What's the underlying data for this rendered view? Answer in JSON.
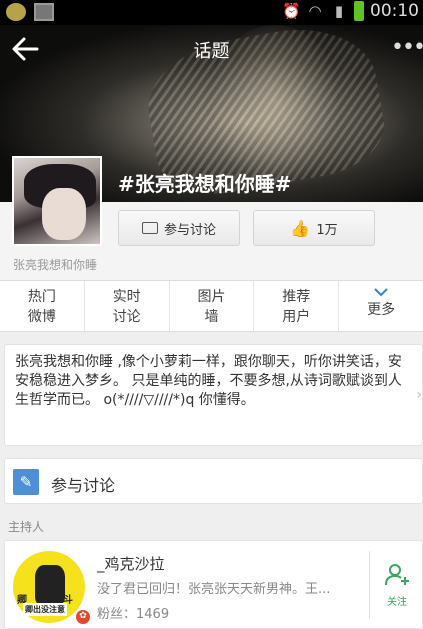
{
  "status_bar": {
    "time": "00:10"
  },
  "nav": {
    "title": "话题"
  },
  "topic": {
    "title": "#张亮我想和你睡#",
    "host_display_name": "张亮我想和你睡"
  },
  "actions": {
    "discuss_label": "参与讨论",
    "like_count": "1万"
  },
  "tabs": [
    {
      "line1": "热门",
      "line2": "微博"
    },
    {
      "line1": "实时",
      "line2": "讨论"
    },
    {
      "line1": "图片",
      "line2": "墙"
    },
    {
      "line1": "推荐",
      "line2": "用户"
    },
    {
      "line1": "",
      "line2": "更多"
    }
  ],
  "description": "张亮我想和你睡 ,像个小萝莉一样，跟你聊天，听你讲笑话，安安稳稳进入梦乡。 只是单纯的睡，不要多想,从诗词歌赋谈到人生哲学而已。 o(*////▽////*)q 你懂得。",
  "participate": {
    "label": "参与讨论"
  },
  "host_section": {
    "label": "主持人",
    "username": "_鸡克沙拉",
    "status": "没了君已回归！张亮张天天新男神。王...",
    "fans": "粉丝：1469",
    "follow_label": "关注",
    "avatar_text_left": "卿",
    "avatar_text_right": "斗",
    "avatar_text_bottom": "卿出没注意"
  },
  "colors": {
    "accent_blue": "#3b7fd0",
    "follow_green": "#3aa55c",
    "like_orange": "#e8582b"
  }
}
